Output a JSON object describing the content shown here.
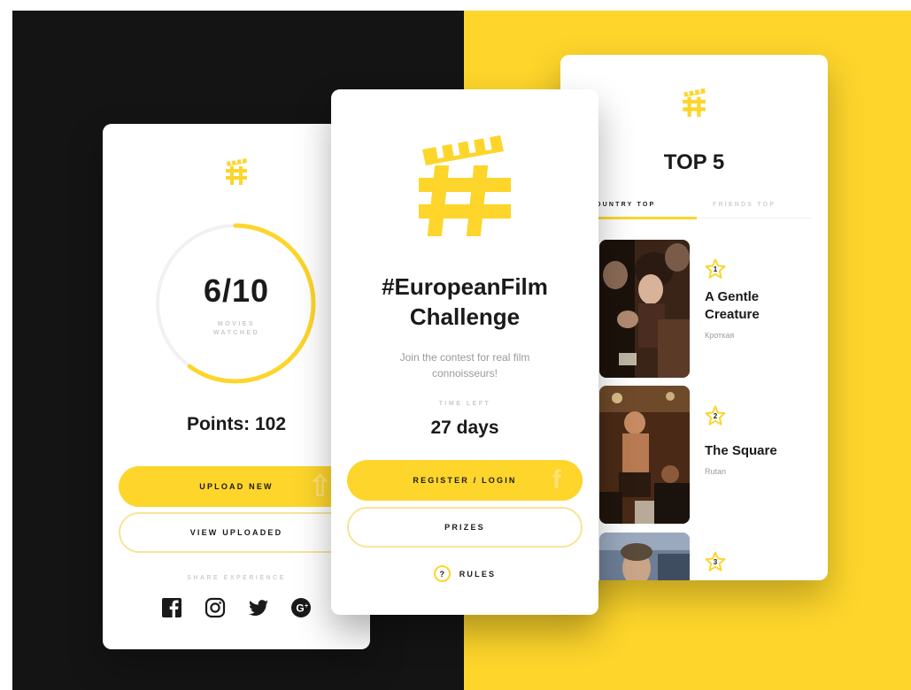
{
  "colors": {
    "accent": "#fdd52b",
    "dark": "#141414",
    "text": "#1a1a1a",
    "muted": "#9a9a9a",
    "faint": "#c9c9c9"
  },
  "left_card": {
    "logo_icon": "clapper-hash-icon",
    "progress": {
      "count": "6/10",
      "watched": 6,
      "total": 10,
      "label_line1": "MOVIES",
      "label_line2": "WATCHED"
    },
    "points": "Points: 102",
    "upload_button": "UPLOAD NEW",
    "view_button": "VIEW UPLOADED",
    "share_label": "SHARE EXPERIENCE",
    "social_icons": [
      "facebook-icon",
      "instagram-icon",
      "twitter-icon",
      "google-plus-icon"
    ]
  },
  "mid_card": {
    "logo_icon": "clapper-hash-icon",
    "title_line1": "#EuropeanFilm",
    "title_line2": "Challenge",
    "subtitle": "Join the contest for real film connoisseurs!",
    "time_label": "TIME LEFT",
    "time_value": "27 days",
    "register_button": "REGISTER / LOGIN",
    "prizes_button": "PRIZES",
    "rules_icon": "?",
    "rules_label": "RULES"
  },
  "right_card": {
    "logo_icon": "clapper-hash-icon",
    "title": "TOP 5",
    "tabs": [
      {
        "label": "OUNTRY TOP",
        "active": true
      },
      {
        "label": "FRIENDS TOP",
        "active": false
      }
    ],
    "films": [
      {
        "rank": "1",
        "title_line1": "A Gentle",
        "title_line2": "Creature",
        "original": "Кроткая"
      },
      {
        "rank": "2",
        "title_line1": "The Square",
        "title_line2": "",
        "original": "Rutan"
      },
      {
        "rank": "3",
        "title_line1": "",
        "title_line2": "",
        "original": ""
      }
    ]
  }
}
